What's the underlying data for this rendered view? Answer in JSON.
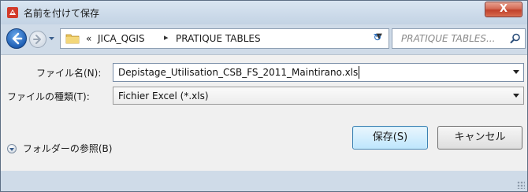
{
  "window": {
    "title": "名前を付けて保存",
    "close_label": "X"
  },
  "navigation": {
    "breadcrumb_prefix": "«",
    "breadcrumbs": [
      "JICA_QGIS",
      "PRATIQUE TABLES"
    ],
    "separator": "▸",
    "search_placeholder": "PRATIQUE TABLES..."
  },
  "form": {
    "filename_label": "ファイル名(N):",
    "filename_value": "Depistage_Utilisation_CSB_FS_2011_Maintirano.xls",
    "filetype_label": "ファイルの種類(T):",
    "filetype_value": "Fichier Excel (*.xls)"
  },
  "footer": {
    "browse_folders_label": "フォルダーの参照(B)",
    "save_label": "保存(S)",
    "cancel_label": "キャンセル"
  },
  "colors": {
    "accent": "#3c7fb1",
    "close": "#c0412b",
    "titlebar": "#c3d3e4"
  }
}
